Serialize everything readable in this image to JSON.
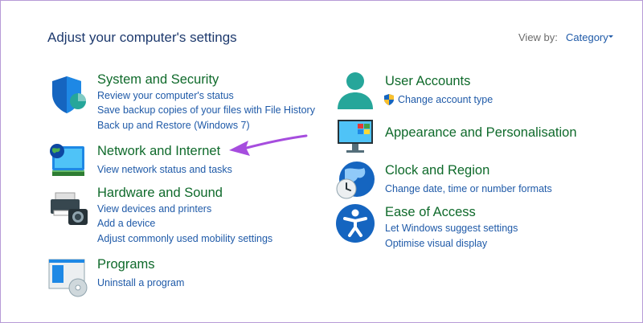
{
  "header": {
    "title": "Adjust your computer's settings",
    "view_by_label": "View by:",
    "view_by_value": "Category"
  },
  "categories": {
    "system": {
      "title": "System and Security",
      "icon": "security-shield-icon",
      "links": [
        "Review your computer's status",
        "Save backup copies of your files with File History",
        "Back up and Restore (Windows 7)"
      ]
    },
    "network": {
      "title": "Network and Internet",
      "icon": "network-globe-monitor-icon",
      "links": [
        "View network status and tasks"
      ]
    },
    "hardware": {
      "title": "Hardware and Sound",
      "icon": "printer-camera-icon",
      "links": [
        "View devices and printers",
        "Add a device",
        "Adjust commonly used mobility settings"
      ]
    },
    "programs": {
      "title": "Programs",
      "icon": "programs-disc-icon",
      "links": [
        "Uninstall a program"
      ]
    },
    "users": {
      "title": "User Accounts",
      "icon": "user-account-icon",
      "links": [
        "Change account type"
      ]
    },
    "appearance": {
      "title": "Appearance and Personalisation",
      "icon": "monitor-tiles-icon",
      "links": []
    },
    "clock": {
      "title": "Clock and Region",
      "icon": "clock-globe-icon",
      "links": [
        "Change date, time or number formats"
      ]
    },
    "ease": {
      "title": "Ease of Access",
      "icon": "accessibility-icon",
      "links": [
        "Let Windows suggest settings",
        "Optimise visual display"
      ]
    }
  },
  "annotation": {
    "arrow_color": "#a64dde",
    "icon": "arrow-pointer-icon"
  },
  "colors": {
    "title_green": "#0f6a2b",
    "link_blue": "#1f5aa8",
    "header_blue": "#1e3a6e",
    "frame_border": "#b79bd6"
  }
}
